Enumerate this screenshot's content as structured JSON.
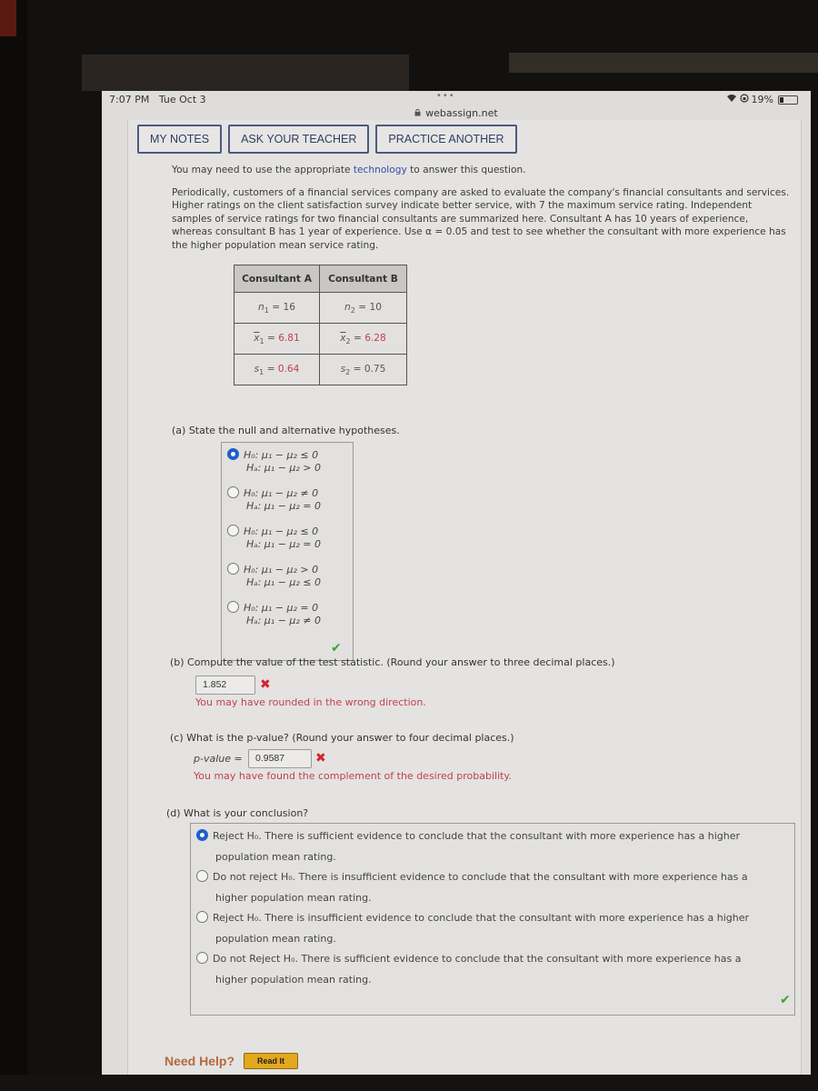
{
  "device": {
    "time": "7:07 PM",
    "date": "Tue Oct 3",
    "dots": "•••",
    "battery_percent": "19%",
    "battery_level": 0.19,
    "url": "webassign.net"
  },
  "toolbar": {
    "my_notes": "MY NOTES",
    "ask_teacher": "ASK YOUR TEACHER",
    "practice_another": "PRACTICE ANOTHER"
  },
  "question": {
    "intro_prefix": "You may need to use the appropriate ",
    "intro_link": "technology",
    "intro_suffix": " to answer this question.",
    "body": "Periodically, customers of a financial services company are asked to evaluate the company's financial consultants and services. Higher ratings on the client satisfaction survey indicate better service, with 7 the maximum service rating. Independent samples of service ratings for two financial consultants are summarized here. Consultant A has 10 years of experience, whereas consultant B has 1 year of experience. Use α = 0.05 and test to see whether the consultant with more experience has the higher population mean service rating."
  },
  "table": {
    "headers": [
      "Consultant A",
      "Consultant B"
    ],
    "rows": [
      [
        {
          "sym": "n",
          "sub": "1",
          "eq": " = ",
          "val": "16"
        },
        {
          "sym": "n",
          "sub": "2",
          "eq": " = ",
          "val": "10"
        }
      ],
      [
        {
          "sym": "x",
          "sub": "1",
          "eq": " = ",
          "val": "6.81"
        },
        {
          "sym": "x",
          "sub": "2",
          "eq": " = ",
          "val": "6.28"
        }
      ],
      [
        {
          "sym": "s",
          "sub": "1",
          "eq": " = ",
          "val": "0.64"
        },
        {
          "sym": "s",
          "sub": "2",
          "eq": " = ",
          "val": "0.75"
        }
      ]
    ]
  },
  "part_a": {
    "label": "(a)  State the null and alternative hypotheses.",
    "options": [
      {
        "h0": "H₀: μ₁ − μ₂ ≤ 0",
        "ha": "Hₐ: μ₁ − μ₂ > 0",
        "selected": true
      },
      {
        "h0": "H₀: μ₁ − μ₂ ≠ 0",
        "ha": "Hₐ: μ₁ − μ₂ = 0",
        "selected": false
      },
      {
        "h0": "H₀: μ₁ − μ₂ ≤ 0",
        "ha": "Hₐ: μ₁ − μ₂ = 0",
        "selected": false
      },
      {
        "h0": "H₀: μ₁ − μ₂ > 0",
        "ha": "Hₐ: μ₁ − μ₂ ≤ 0",
        "selected": false
      },
      {
        "h0": "H₀: μ₁ − μ₂ = 0",
        "ha": "Hₐ: μ₁ − μ₂ ≠ 0",
        "selected": false
      }
    ],
    "status": "correct"
  },
  "part_b": {
    "label": "(b)  Compute the value of the test statistic. (Round your answer to three decimal places.)",
    "answer": "1.852",
    "status": "incorrect",
    "feedback": "You may have rounded in the wrong direction."
  },
  "part_c": {
    "label": "(c)  What is the p-value? (Round your answer to four decimal places.)",
    "field_label": "p-value =",
    "answer": "0.9587",
    "status": "incorrect",
    "feedback": "You may have found the complement of the desired probability."
  },
  "part_d": {
    "label": "(d)  What is your conclusion?",
    "options": [
      {
        "line1": "Reject H₀. There is sufficient evidence to conclude that the consultant with more experience has a higher",
        "line2": "population mean rating.",
        "selected": true
      },
      {
        "line1": "Do not reject H₀. There is insufficient evidence to conclude that the consultant with more experience has a",
        "line2": "higher population mean rating.",
        "selected": false
      },
      {
        "line1": "Reject H₀. There is insufficient evidence to conclude that the consultant with more experience has a higher",
        "line2": "population mean rating.",
        "selected": false
      },
      {
        "line1": "Do not Reject H₀. There is sufficient evidence to conclude that the consultant with more experience has a",
        "line2": "higher population mean rating.",
        "selected": false
      }
    ],
    "status": "correct"
  },
  "help": {
    "need_help": "Need Help?",
    "read_it": "Read It"
  },
  "icons": {
    "check": "✔",
    "x": "✖",
    "wifi": "ᯤ",
    "lock": "🔒"
  }
}
